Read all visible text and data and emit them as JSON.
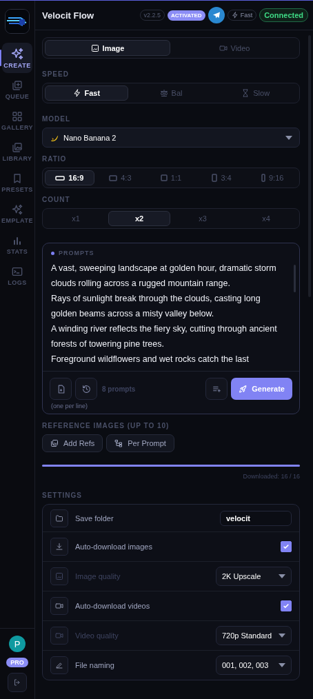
{
  "header": {
    "title": "Velocit Flow",
    "version": "v2.2.5",
    "license_badge": "ACTIVATED",
    "speed_badge": "Fast",
    "connection": "Connected"
  },
  "sidebar": {
    "items": [
      {
        "label": "CREATE",
        "selected": true
      },
      {
        "label": "QUEUE",
        "selected": false
      },
      {
        "label": "GALLERY",
        "selected": false
      },
      {
        "label": "LIBRARY",
        "selected": false
      },
      {
        "label": "PRESETS",
        "selected": false
      },
      {
        "label": "EMPLATE",
        "selected": false
      },
      {
        "label": "STATS",
        "selected": false
      },
      {
        "label": "LOGS",
        "selected": false
      }
    ],
    "avatar": "P",
    "plan_badge": "PRO"
  },
  "mode_tabs": [
    {
      "label": "Image",
      "selected": true
    },
    {
      "label": "Video",
      "selected": false
    }
  ],
  "speed": {
    "label": "SPEED",
    "options": [
      {
        "label": "Fast",
        "selected": true
      },
      {
        "label": "Bal",
        "selected": false
      },
      {
        "label": "Slow",
        "selected": false
      }
    ]
  },
  "model": {
    "label": "MODEL",
    "value": "Nano Banana 2"
  },
  "ratio": {
    "label": "RATIO",
    "options": [
      {
        "label": "16:9",
        "selected": true
      },
      {
        "label": "4:3",
        "selected": false
      },
      {
        "label": "1:1",
        "selected": false
      },
      {
        "label": "3:4",
        "selected": false
      },
      {
        "label": "9:16",
        "selected": false
      }
    ]
  },
  "count": {
    "label": "COUNT",
    "options": [
      {
        "label": "x1",
        "selected": false
      },
      {
        "label": "x2",
        "selected": true
      },
      {
        "label": "x3",
        "selected": false
      },
      {
        "label": "x4",
        "selected": false
      }
    ]
  },
  "prompts": {
    "label": "PROMPTS",
    "value": "A vast, sweeping landscape at golden hour, dramatic storm clouds rolling across a rugged mountain range.\nRays of sunlight break through the clouds, casting long golden beams across a misty valley below.\nA winding river reflects the fiery sky, cutting through ancient forests of towering pine trees.\nForeground wildflowers and wet rocks catch the last",
    "count": "8 prompts",
    "generate": "Generate",
    "hint": "(one per line)"
  },
  "reference": {
    "label": "REFERENCE IMAGES (UP TO 10)",
    "buttons": [
      "Add Refs",
      "Per Prompt"
    ]
  },
  "download": {
    "level": 1,
    "status": "Downloaded: 16 / 16"
  },
  "settings": {
    "label": "SETTINGS",
    "rows": [
      {
        "kind": "text",
        "label": "Save folder",
        "value": "velocit",
        "disabled": false
      },
      {
        "kind": "checkbox",
        "label": "Auto-download images",
        "checked": true,
        "disabled": false
      },
      {
        "kind": "select",
        "label": "Image quality",
        "value": "2K Upscale",
        "disabled": true
      },
      {
        "kind": "checkbox",
        "label": "Auto-download videos",
        "checked": true,
        "disabled": false
      },
      {
        "kind": "select",
        "label": "Video quality",
        "value": "720p Standard",
        "disabled": true
      },
      {
        "kind": "select",
        "label": "File naming",
        "value": "001, 002, 003",
        "disabled": false
      }
    ]
  }
}
